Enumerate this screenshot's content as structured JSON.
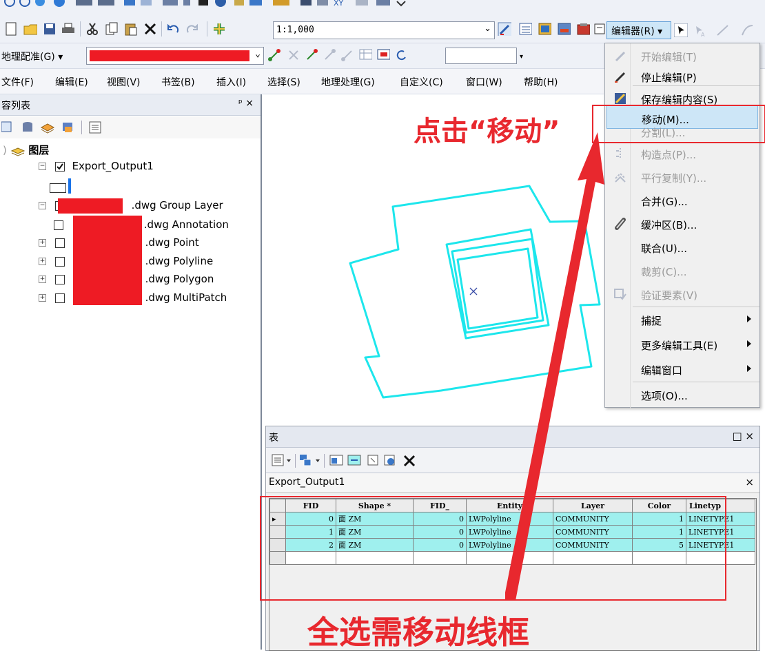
{
  "toolbar_row2": {
    "scale_value": "1:1,000",
    "editor_menu_label": "编辑器(R) ▾"
  },
  "toolbar_row3": {
    "georef_label": "地理配准(G) ▾"
  },
  "menubar": {
    "items": [
      "文件(F)",
      "编辑(E)",
      "视图(V)",
      "书签(B)",
      "插入(I)",
      "选择(S)",
      "地理处理(G)",
      "自定义(C)",
      "窗口(W)",
      "帮助(H)"
    ]
  },
  "toc": {
    "title": "容列表",
    "pin": "ᵖ ×",
    "layers_root": "图层",
    "export_layer": "Export_Output1",
    "group_layer": ".dwg Group Layer",
    "sublayers": [
      ".dwg Annotation",
      ".dwg Point",
      ".dwg Polyline",
      ".dwg Polygon",
      ".dwg MultiPatch"
    ]
  },
  "editor_menu": {
    "items": [
      {
        "label": "开始编辑(T)",
        "enabled": false,
        "icon": "start-edit-icon"
      },
      {
        "label": "停止编辑(P)",
        "enabled": true,
        "icon": "stop-edit-icon"
      },
      {
        "label": "保存编辑内容(S)",
        "enabled": true,
        "icon": "save-edits-icon"
      },
      {
        "label": "移动(M)...",
        "enabled": true,
        "highlighted": true
      },
      {
        "label": "分割(L)...",
        "enabled": false
      },
      {
        "label": "构造点(P)...",
        "enabled": false,
        "icon": "construct-points-icon"
      },
      {
        "label": "平行复制(Y)...",
        "enabled": false,
        "icon": "copy-parallel-icon"
      },
      {
        "label": "合并(G)...",
        "enabled": true
      },
      {
        "label": "缓冲区(B)...",
        "enabled": true,
        "icon": "buffer-icon"
      },
      {
        "label": "联合(U)...",
        "enabled": true
      },
      {
        "label": "裁剪(C)...",
        "enabled": false
      },
      {
        "label": "验证要素(V)",
        "enabled": false,
        "icon": "validate-icon"
      },
      {
        "label": "捕捉",
        "enabled": true,
        "submenu": true
      },
      {
        "label": "更多编辑工具(E)",
        "enabled": true,
        "submenu": true
      },
      {
        "label": "编辑窗口",
        "enabled": true,
        "submenu": true
      },
      {
        "label": "选项(O)...",
        "enabled": true
      }
    ]
  },
  "table_window": {
    "title": "表",
    "window_controls": "□ ×",
    "tab_label": "Export_Output1",
    "tab_close": "×",
    "columns": [
      "FID",
      "Shape *",
      "FID_",
      "Entity",
      "Layer",
      "Color",
      "Linetyp"
    ],
    "rows": [
      {
        "fid": "0",
        "shape": "面 ZM",
        "fid_": "0",
        "entity": "LWPolyline",
        "layer": "COMMUNITY",
        "color": "1",
        "linetype": "LINETYPE1"
      },
      {
        "fid": "1",
        "shape": "面 ZM",
        "fid_": "0",
        "entity": "LWPolyline",
        "layer": "COMMUNITY",
        "color": "1",
        "linetype": "LINETYPE1"
      },
      {
        "fid": "2",
        "shape": "面 ZM",
        "fid_": "0",
        "entity": "LWPolyline",
        "layer": "COMMUNITY",
        "color": "5",
        "linetype": "LINETYPE1"
      }
    ]
  },
  "annotations": {
    "click_move": "点击“移动”",
    "select_all": "全选需移动线框"
  },
  "colors": {
    "annotation_red": "#e8282e",
    "feature_cyan": "#1de6ec",
    "menu_highlight": "#cde6f7",
    "table_row": "#9ff0ee",
    "redaction": "#ee1b24"
  }
}
